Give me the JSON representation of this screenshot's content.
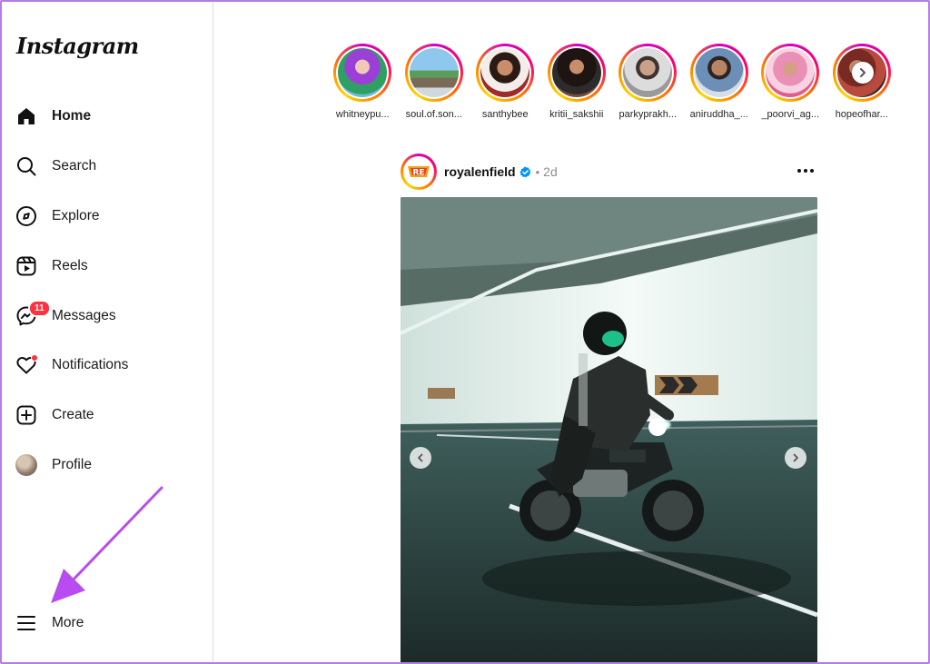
{
  "app": {
    "logo_text": "Instagram"
  },
  "sidebar": {
    "items": [
      {
        "label": "Home",
        "icon": "home-icon",
        "active": true
      },
      {
        "label": "Search",
        "icon": "search-icon"
      },
      {
        "label": "Explore",
        "icon": "compass-icon"
      },
      {
        "label": "Reels",
        "icon": "reels-icon"
      },
      {
        "label": "Messages",
        "icon": "messenger-icon",
        "badge": "11"
      },
      {
        "label": "Notifications",
        "icon": "heart-icon"
      },
      {
        "label": "Create",
        "icon": "plus-square-icon"
      },
      {
        "label": "Profile",
        "icon": "profile-avatar"
      }
    ],
    "more": {
      "label": "More",
      "icon": "menu-icon"
    }
  },
  "stories": [
    {
      "username": "whitneypu..."
    },
    {
      "username": "soul.of.son..."
    },
    {
      "username": "santhybee"
    },
    {
      "username": "kritii_sakshii"
    },
    {
      "username": "parkyprakh..."
    },
    {
      "username": "aniruddha_..."
    },
    {
      "username": "_poorvi_ag..."
    },
    {
      "username": "hopeofhar..."
    }
  ],
  "post": {
    "username": "royalenfield",
    "verified": true,
    "separator": "•",
    "time": "2d"
  },
  "colors": {
    "accent_badge": "#ff3040",
    "verified_blue": "#0095f6",
    "annotation_arrow": "#b84cf0"
  }
}
